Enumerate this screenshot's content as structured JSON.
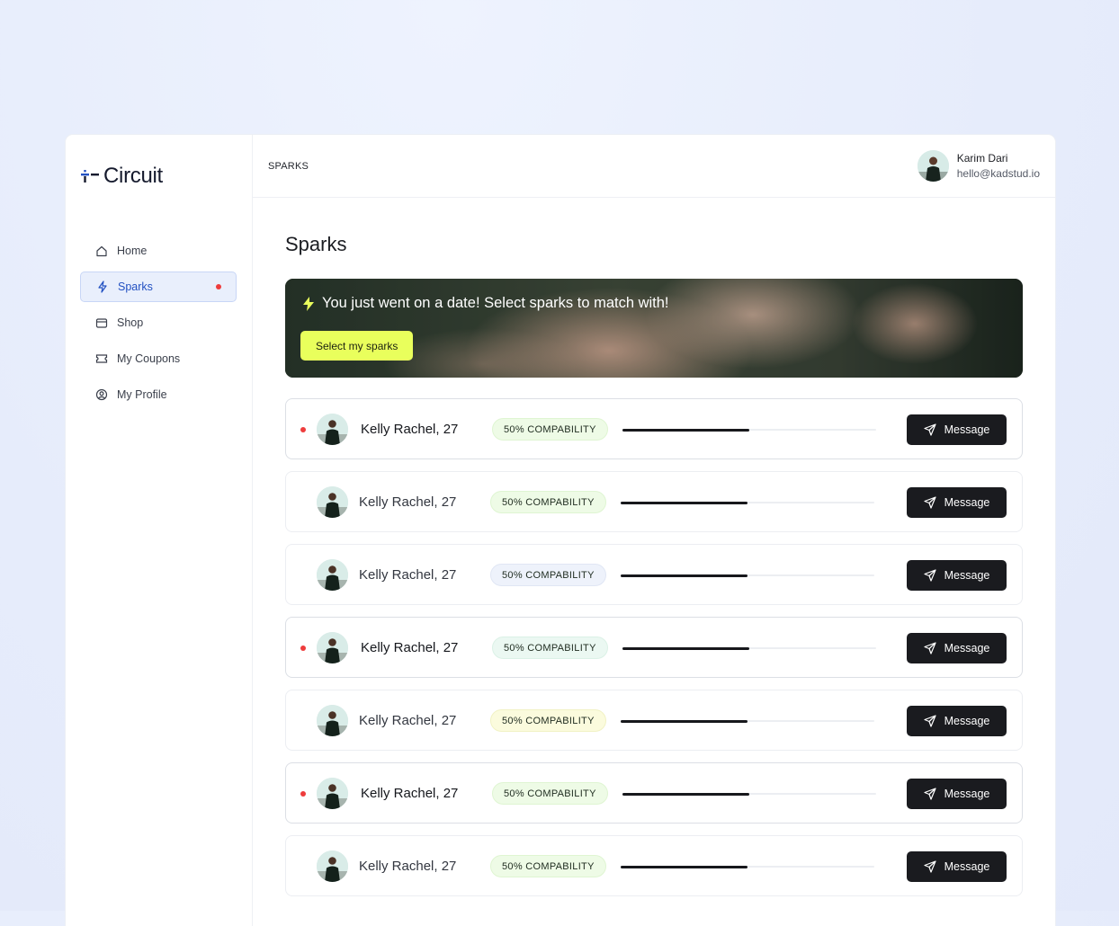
{
  "app": {
    "logo_text": "Circuit"
  },
  "sidebar": {
    "items": [
      {
        "label": "Home",
        "icon": "home-icon",
        "active": false,
        "dot": false
      },
      {
        "label": "Sparks",
        "icon": "spark-icon",
        "active": true,
        "dot": true
      },
      {
        "label": "Shop",
        "icon": "shop-icon",
        "active": false,
        "dot": false
      },
      {
        "label": "My Coupons",
        "icon": "coupon-icon",
        "active": false,
        "dot": false
      },
      {
        "label": "My Profile",
        "icon": "profile-icon",
        "active": false,
        "dot": false
      }
    ]
  },
  "header": {
    "breadcrumb": "SPARKS",
    "user": {
      "name": "Karim Dari",
      "email": "hello@kadstud.io"
    }
  },
  "main": {
    "title": "Sparks",
    "banner": {
      "text": "You just went on a date! Select sparks to match with!",
      "button_label": "Select my sparks",
      "accent": "#e9ff5c"
    },
    "matches": [
      {
        "name": "Kelly Rachel, 27",
        "compatibility_label": "50% COMPABILITY",
        "compatibility": 0.5,
        "unread": true,
        "badge_bg": "#eefbe6",
        "badge_border": "#dff5d2",
        "action": "Message"
      },
      {
        "name": "Kelly Rachel, 27",
        "compatibility_label": "50% COMPABILITY",
        "compatibility": 0.5,
        "unread": false,
        "badge_bg": "#eefbe6",
        "badge_border": "#dff5d2",
        "action": "Message"
      },
      {
        "name": "Kelly Rachel, 27",
        "compatibility_label": "50% COMPABILITY",
        "compatibility": 0.5,
        "unread": false,
        "badge_bg": "#eef2fb",
        "badge_border": "#e0e6f4",
        "action": "Message"
      },
      {
        "name": "Kelly Rachel, 27",
        "compatibility_label": "50% COMPABILITY",
        "compatibility": 0.5,
        "unread": true,
        "badge_bg": "#ebf8f2",
        "badge_border": "#dbf1e6",
        "action": "Message"
      },
      {
        "name": "Kelly Rachel, 27",
        "compatibility_label": "50% COMPABILITY",
        "compatibility": 0.5,
        "unread": false,
        "badge_bg": "#fbfbdd",
        "badge_border": "#f1f2c4",
        "action": "Message"
      },
      {
        "name": "Kelly Rachel, 27",
        "compatibility_label": "50% COMPABILITY",
        "compatibility": 0.5,
        "unread": true,
        "badge_bg": "#eefbe6",
        "badge_border": "#dff5d2",
        "action": "Message"
      },
      {
        "name": "Kelly Rachel, 27",
        "compatibility_label": "50% COMPABILITY",
        "compatibility": 0.5,
        "unread": false,
        "badge_bg": "#eefbe6",
        "badge_border": "#dff5d2",
        "action": "Message"
      }
    ]
  },
  "colors": {
    "primary": "#2351c2",
    "dark": "#1a1b1f",
    "unread_dot": "#ee3c3c"
  }
}
